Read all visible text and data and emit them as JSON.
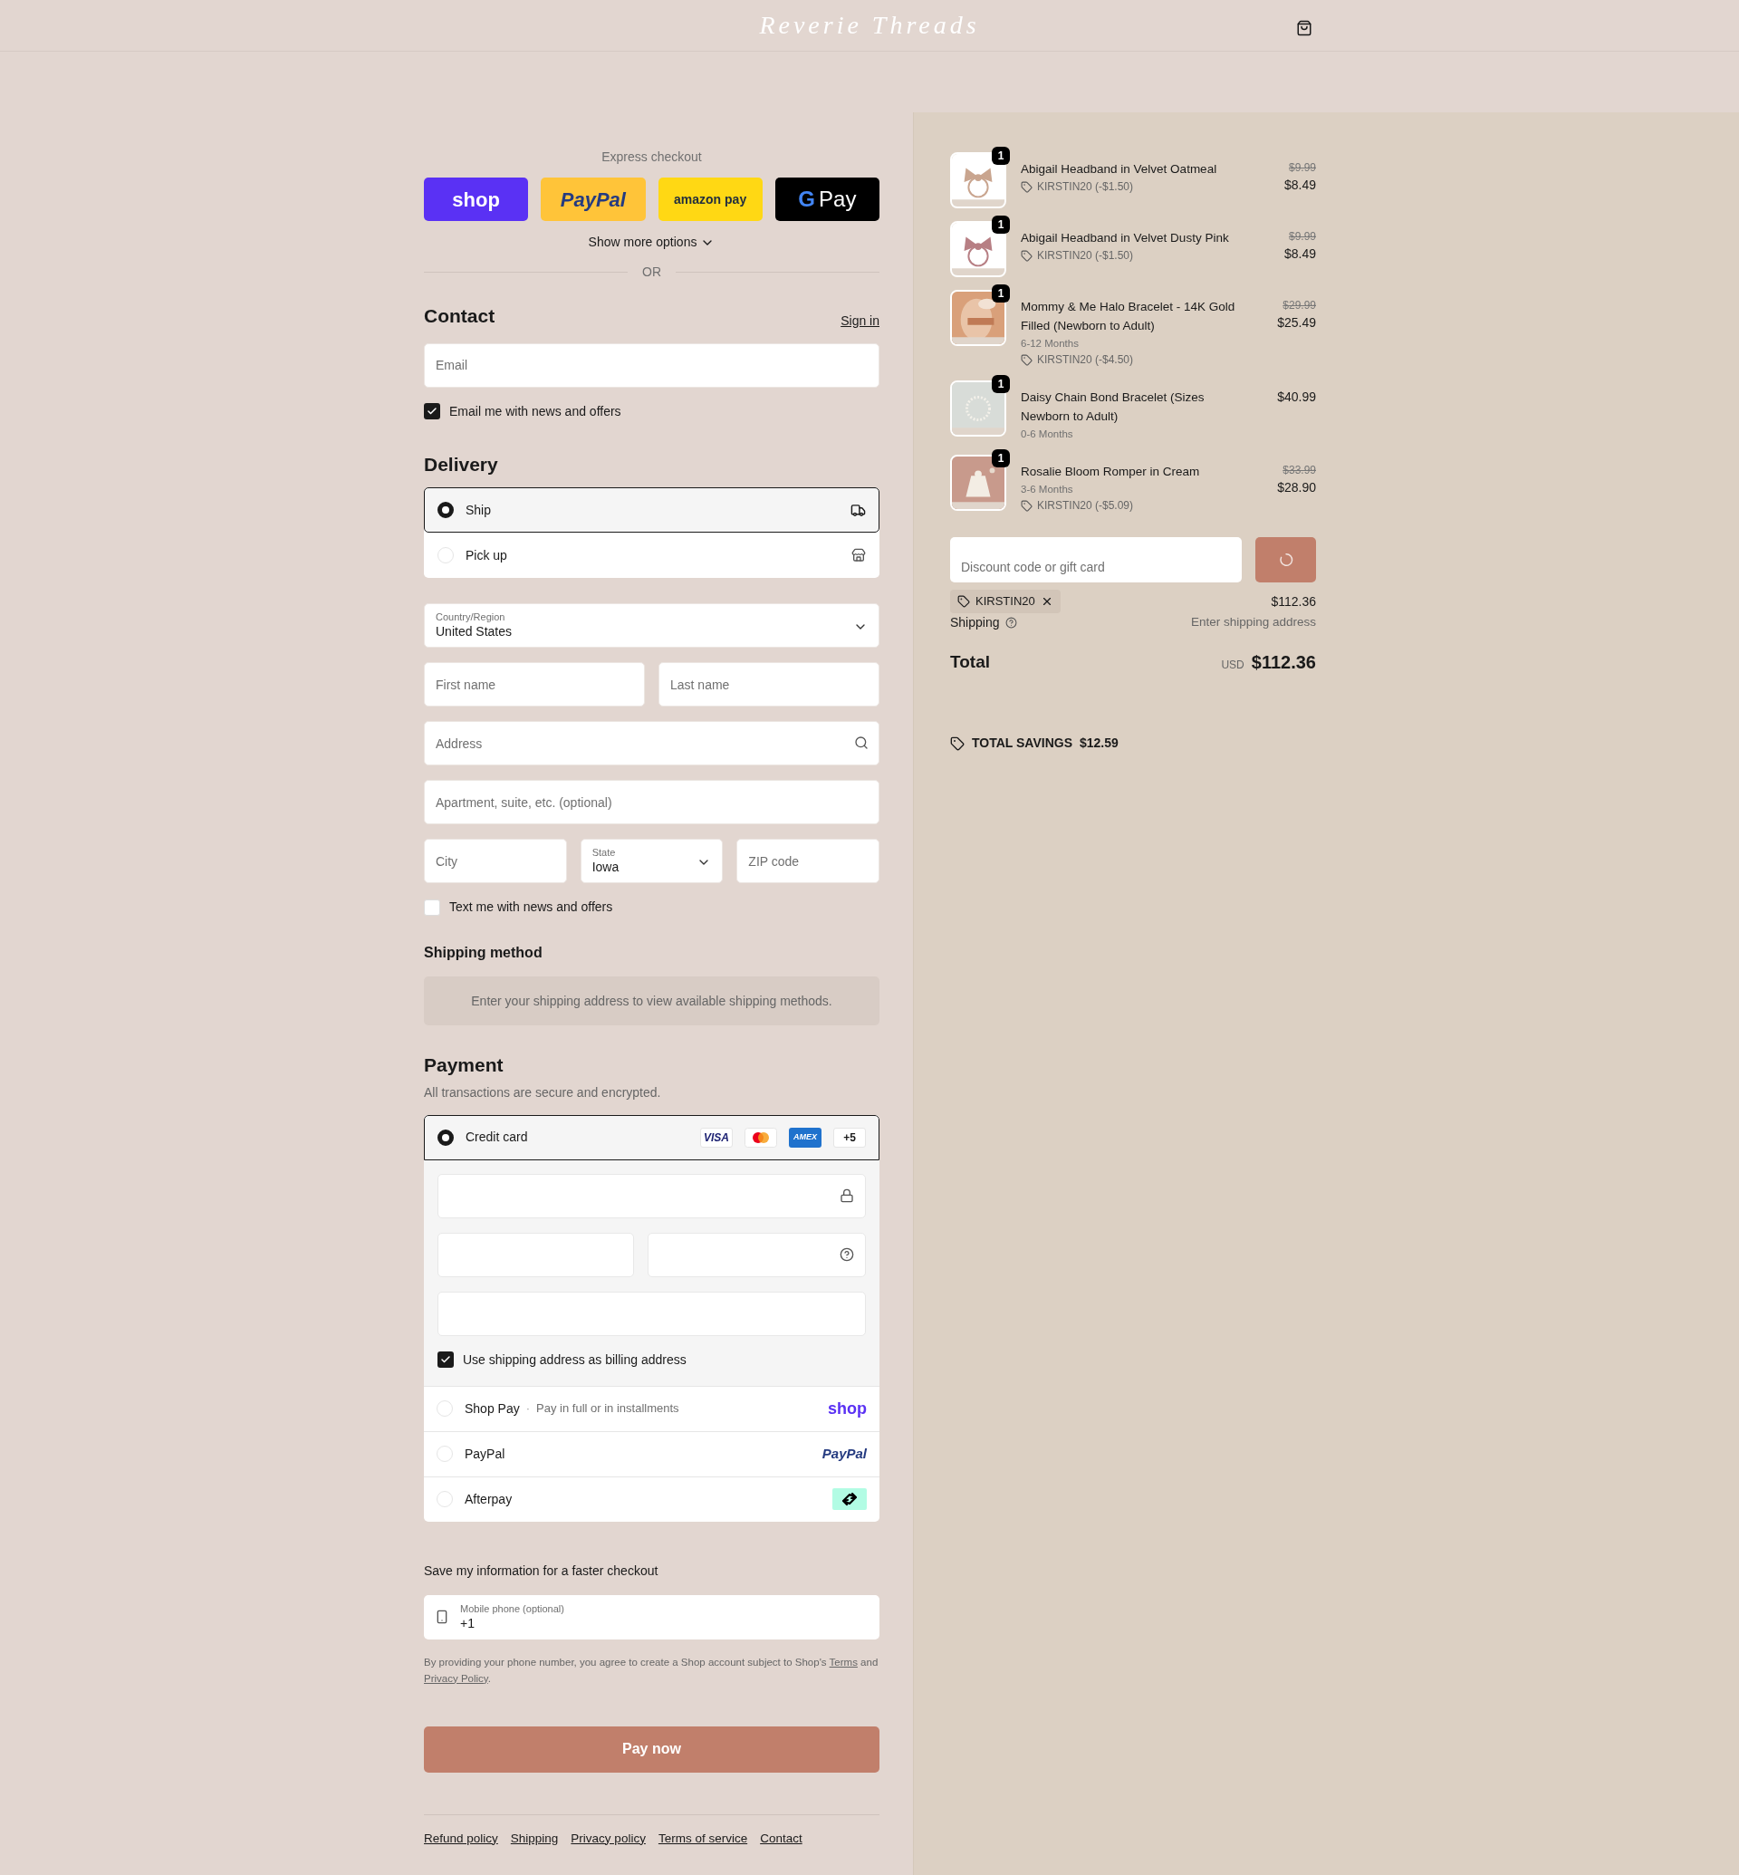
{
  "header": {
    "logo": "Reverie Threads"
  },
  "express": {
    "title": "Express checkout",
    "buttons": [
      {
        "kind": "shop",
        "label": "shop"
      },
      {
        "kind": "paypal",
        "label": "PayPal"
      },
      {
        "kind": "amazon",
        "label": "amazon pay"
      },
      {
        "kind": "gpay",
        "logo_mark": "G",
        "label": "Pay"
      }
    ],
    "more": "Show more options",
    "divider": "OR"
  },
  "contact": {
    "title": "Contact",
    "sign_in": "Sign in",
    "email": {
      "placeholder": "Email"
    },
    "news": {
      "label": "Email me with news and offers",
      "checked": true
    }
  },
  "delivery": {
    "title": "Delivery",
    "options": [
      {
        "kind": "ship",
        "label": "Ship",
        "selected": true
      },
      {
        "kind": "pickup",
        "label": "Pick up",
        "selected": false
      }
    ],
    "country": {
      "label": "Country/Region",
      "value": "United States"
    },
    "first_name": {
      "placeholder": "First name"
    },
    "last_name": {
      "placeholder": "Last name"
    },
    "address": {
      "placeholder": "Address"
    },
    "apartment": {
      "placeholder": "Apartment, suite, etc. (optional)"
    },
    "city": {
      "placeholder": "City"
    },
    "state": {
      "label": "State",
      "value": "Iowa"
    },
    "zip": {
      "placeholder": "ZIP code"
    },
    "text_me": {
      "label": "Text me with news and offers",
      "checked": false
    }
  },
  "shipping_method": {
    "title": "Shipping method",
    "message": "Enter your shipping address to view available shipping methods."
  },
  "payment": {
    "title": "Payment",
    "subtitle": "All transactions are secure and encrypted.",
    "methods": [
      {
        "kind": "card",
        "label": "Credit card",
        "selected": true,
        "badges": [
          {
            "kind": "visa",
            "label": "VISA"
          },
          {
            "kind": "mastercard"
          },
          {
            "kind": "amex",
            "label": "AMEX"
          },
          {
            "kind": "more",
            "label": "+5"
          }
        ]
      },
      {
        "kind": "shop",
        "label": "Shop Pay",
        "separator": "·",
        "note": "Pay in full or in installments",
        "logo": "shop",
        "selected": false
      },
      {
        "kind": "paypal",
        "label": "PayPal",
        "logo": "PayPal",
        "selected": false
      },
      {
        "kind": "afterpay",
        "label": "Afterpay",
        "selected": false
      }
    ],
    "billing": {
      "label": "Use shipping address as billing address",
      "checked": true
    }
  },
  "save_info": {
    "title": "Save my information for a faster checkout",
    "phone": {
      "label": "Mobile phone (optional)",
      "value": "+1"
    },
    "terms": {
      "before": "By providing your phone number, you agree to create a Shop account subject to Shop's",
      "terms_link": "Terms",
      "middle": "and",
      "privacy_link": "Privacy Policy",
      "after": "."
    }
  },
  "pay_button": "Pay now",
  "footer_links": [
    "Refund policy",
    "Shipping",
    "Privacy policy",
    "Terms of service",
    "Contact"
  ],
  "summary": {
    "items": [
      {
        "qty": "1",
        "title": "Abigail Headband in Velvet Oatmeal",
        "discount": "KIRSTIN20 (-$1.50)",
        "compare_price": "$9.99",
        "price": "$8.49"
      },
      {
        "qty": "1",
        "title": "Abigail Headband in Velvet Dusty Pink",
        "discount": "KIRSTIN20 (-$1.50)",
        "compare_price": "$9.99",
        "price": "$8.49"
      },
      {
        "qty": "1",
        "title": "Mommy & Me Halo Bracelet - 14K Gold Filled (Newborn to Adult)",
        "variant": "6-12 Months",
        "discount": "KIRSTIN20 (-$4.50)",
        "compare_price": "$29.99",
        "price": "$25.49"
      },
      {
        "qty": "1",
        "title": "Daisy Chain Bond Bracelet (Sizes Newborn to Adult)",
        "variant": "0-6 Months",
        "price": "$40.99"
      },
      {
        "qty": "1",
        "title": "Rosalie Bloom Romper in Cream",
        "variant": "3-6 Months",
        "discount": "KIRSTIN20 (-$5.09)",
        "compare_price": "$33.99",
        "price": "$28.90"
      }
    ],
    "discount_field": {
      "placeholder": "Discount code or gift card"
    },
    "applied_code": "KIRSTIN20",
    "subtotal_value": "$112.36",
    "shipping_label": "Shipping",
    "shipping_value": "Enter shipping address",
    "total_label": "Total",
    "currency": "USD",
    "total": "$112.36",
    "savings_label": "TOTAL SAVINGS",
    "savings": "$12.59"
  }
}
